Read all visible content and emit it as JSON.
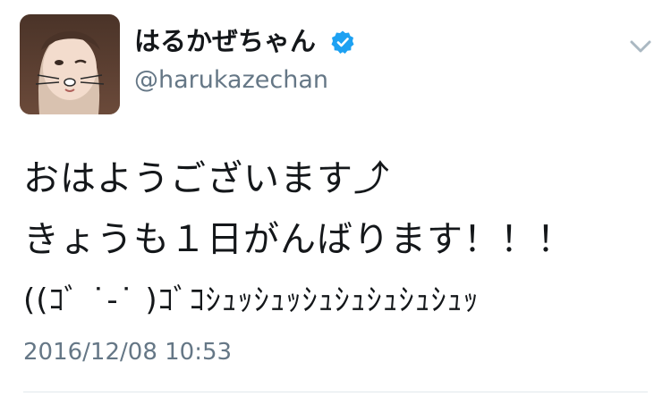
{
  "user": {
    "display_name": "はるかぜちゃん",
    "handle": "@harukazechan",
    "avatar_icon": "profile-photo",
    "verified_icon": "verified-badge-icon"
  },
  "tweet": {
    "lines": [
      "おはようございます⤴",
      "きょうも１日がんばります！！！",
      "((ｺﾞ ˙-˙ )ｺﾞｺｼｭｯｼｭｯｼｭｼｭｼｭｼｭｼｭｯ"
    ],
    "timestamp": "2016/12/08 10:53"
  },
  "menu": {
    "caret_icon": "chevron-down-icon"
  },
  "colors": {
    "text": "#14171a",
    "secondary": "#657786",
    "verified": "#1da1f2",
    "divider": "#e1e8ed"
  }
}
